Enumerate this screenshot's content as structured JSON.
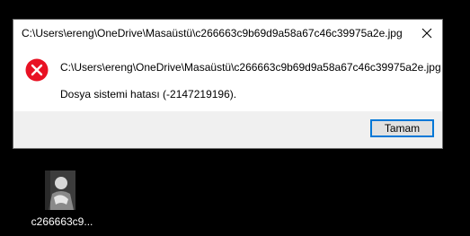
{
  "dialog": {
    "title": "C:\\Users\\ereng\\OneDrive\\Masaüstü\\c266663c9b69d9a58a67c46c39975a2e.jpg",
    "message_path": "C:\\Users\\ereng\\OneDrive\\Masaüstü\\c266663c9b69d9a58a67c46c39975a2e.jpg",
    "message_error": "Dosya sistemi hatası (-2147219196).",
    "ok_label": "Tamam",
    "close_icon": "close-icon",
    "status_icon": "error-icon",
    "accent_color": "#0078d7",
    "error_color": "#e81123"
  },
  "desktop": {
    "background_color": "#000000",
    "icons": [
      {
        "label": "c266663c9...",
        "icon": "image-file-thumbnail"
      }
    ]
  }
}
